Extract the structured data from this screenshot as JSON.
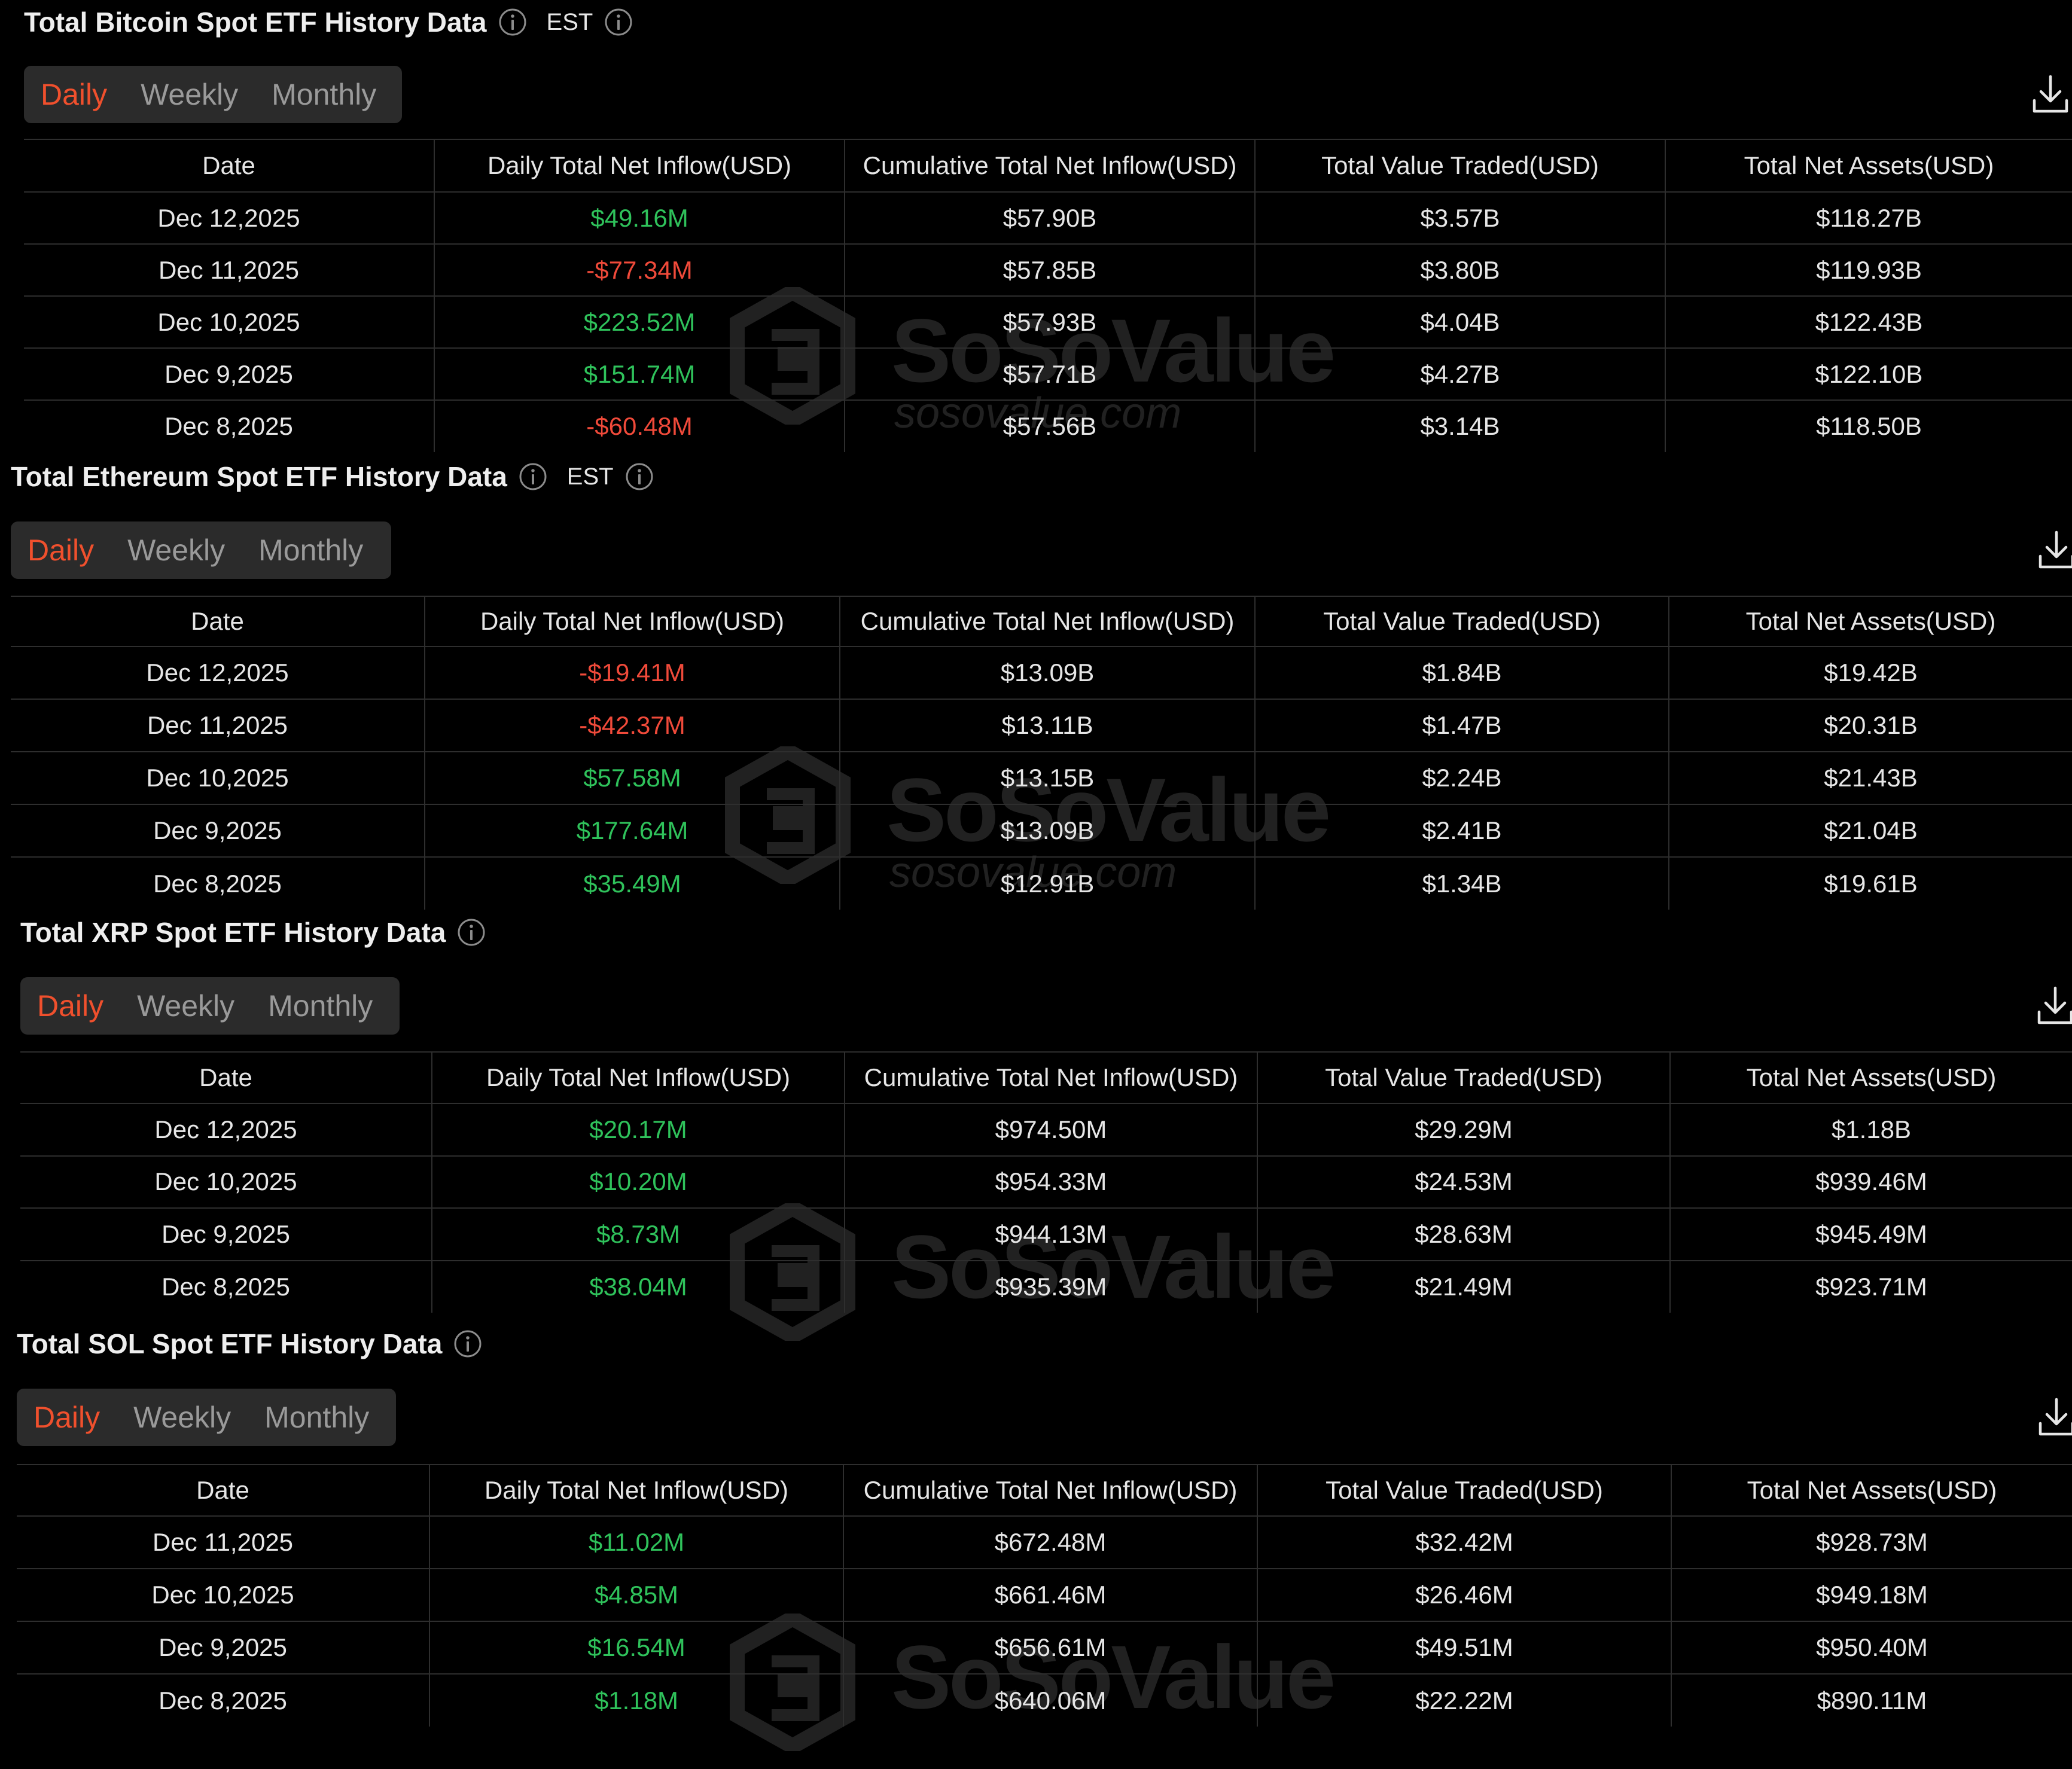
{
  "columns": [
    "Date",
    "Daily Total Net Inflow(USD)",
    "Cumulative Total Net Inflow(USD)",
    "Total Value Traded(USD)",
    "Total Net Assets(USD)"
  ],
  "tabs": [
    "Daily",
    "Weekly",
    "Monthly"
  ],
  "colors": {
    "positive": "#2fc25b",
    "negative": "#f04a3a",
    "active_tab": "#f0502d",
    "tab_bg": "#2b2b2b"
  },
  "watermark": {
    "brand": "SoSoValue",
    "url": "sosovalue.com"
  },
  "sections": [
    {
      "title": "Total Bitcoin Spot ETF History Data",
      "timezone": "EST",
      "rows": [
        [
          "Dec 12,2025",
          "$49.16M",
          "$57.90B",
          "$3.57B",
          "$118.27B"
        ],
        [
          "Dec 11,2025",
          "-$77.34M",
          "$57.85B",
          "$3.80B",
          "$119.93B"
        ],
        [
          "Dec 10,2025",
          "$223.52M",
          "$57.93B",
          "$4.04B",
          "$122.43B"
        ],
        [
          "Dec 9,2025",
          "$151.74M",
          "$57.71B",
          "$4.27B",
          "$122.10B"
        ],
        [
          "Dec 8,2025",
          "-$60.48M",
          "$57.56B",
          "$3.14B",
          "$118.50B"
        ]
      ]
    },
    {
      "title": "Total Ethereum Spot ETF History Data",
      "timezone": "EST",
      "rows": [
        [
          "Dec 12,2025",
          "-$19.41M",
          "$13.09B",
          "$1.84B",
          "$19.42B"
        ],
        [
          "Dec 11,2025",
          "-$42.37M",
          "$13.11B",
          "$1.47B",
          "$20.31B"
        ],
        [
          "Dec 10,2025",
          "$57.58M",
          "$13.15B",
          "$2.24B",
          "$21.43B"
        ],
        [
          "Dec 9,2025",
          "$177.64M",
          "$13.09B",
          "$2.41B",
          "$21.04B"
        ],
        [
          "Dec 8,2025",
          "$35.49M",
          "$12.91B",
          "$1.34B",
          "$19.61B"
        ]
      ]
    },
    {
      "title": "Total XRP Spot ETF History Data",
      "timezone": "",
      "rows": [
        [
          "Dec 12,2025",
          "$20.17M",
          "$974.50M",
          "$29.29M",
          "$1.18B"
        ],
        [
          "Dec 10,2025",
          "$10.20M",
          "$954.33M",
          "$24.53M",
          "$939.46M"
        ],
        [
          "Dec 9,2025",
          "$8.73M",
          "$944.13M",
          "$28.63M",
          "$945.49M"
        ],
        [
          "Dec 8,2025",
          "$38.04M",
          "$935.39M",
          "$21.49M",
          "$923.71M"
        ]
      ]
    },
    {
      "title": "Total SOL Spot ETF History Data",
      "timezone": "",
      "rows": [
        [
          "Dec 11,2025",
          "$11.02M",
          "$672.48M",
          "$32.42M",
          "$928.73M"
        ],
        [
          "Dec 10,2025",
          "$4.85M",
          "$661.46M",
          "$26.46M",
          "$949.18M"
        ],
        [
          "Dec 9,2025",
          "$16.54M",
          "$656.61M",
          "$49.51M",
          "$950.40M"
        ],
        [
          "Dec 8,2025",
          "$1.18M",
          "$640.06M",
          "$22.22M",
          "$890.11M"
        ]
      ]
    }
  ]
}
